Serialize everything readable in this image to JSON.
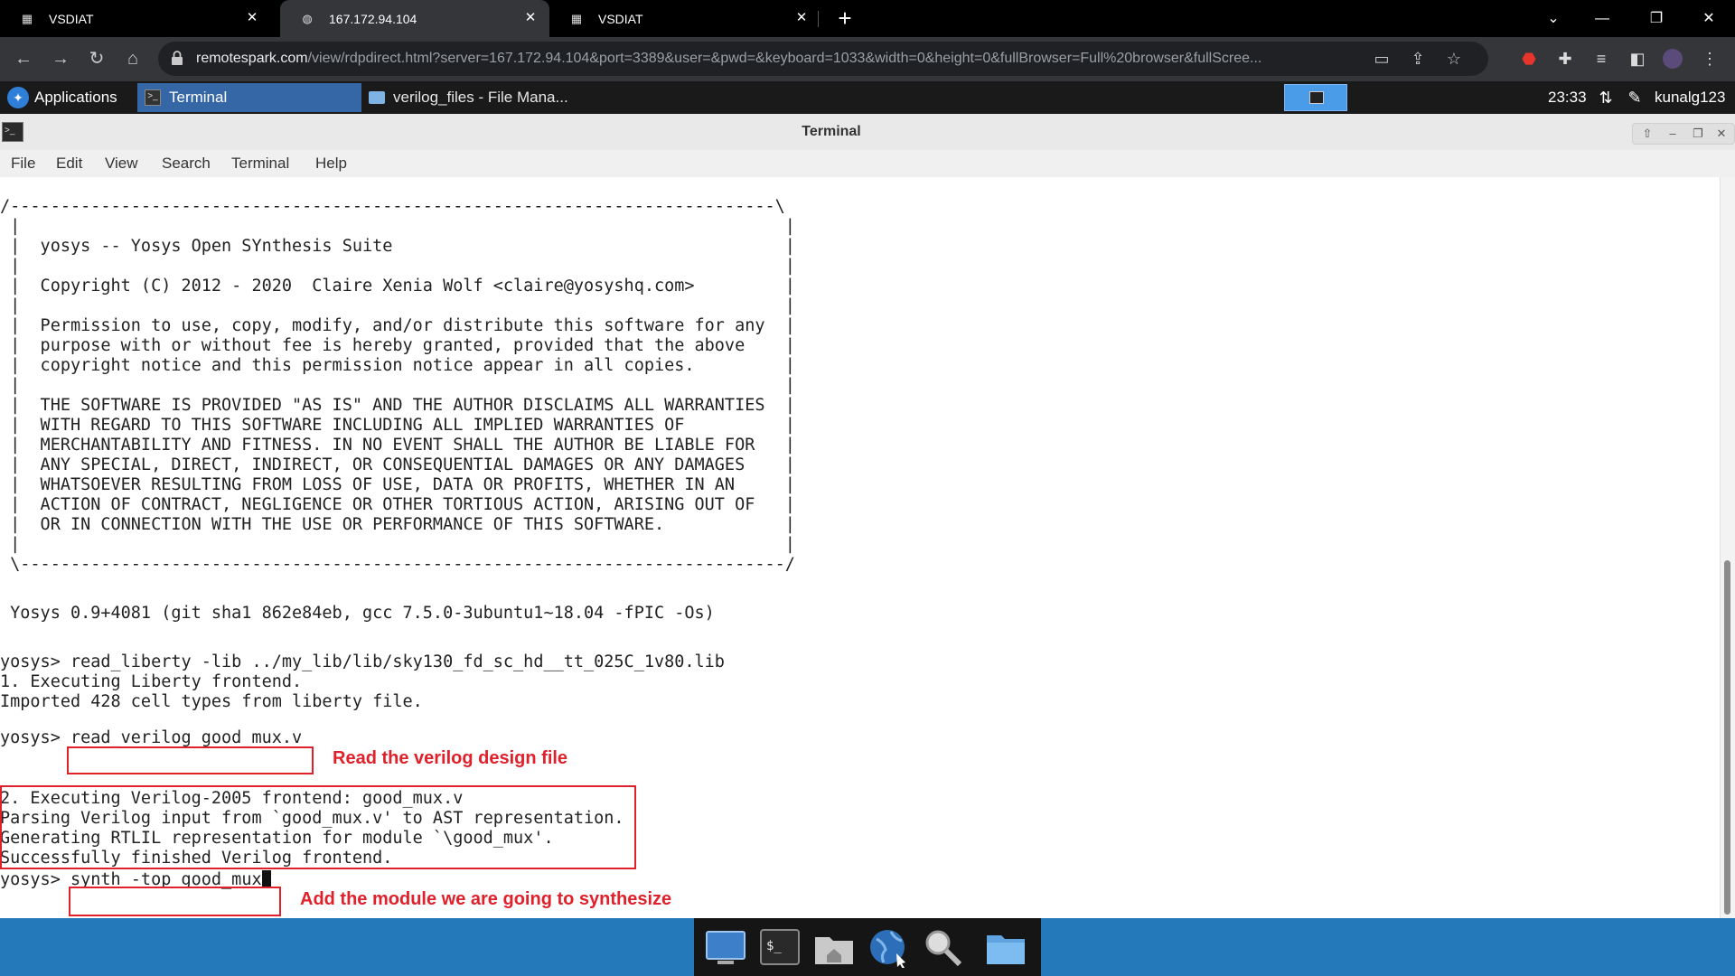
{
  "browser": {
    "tabs": [
      {
        "label": "VSDIAT",
        "active": false
      },
      {
        "label": "167.172.94.104",
        "active": true
      },
      {
        "label": "VSDIAT",
        "active": false
      }
    ],
    "url_domain": "remotespark.com",
    "url_path": "/view/rdpdirect.html?server=167.172.94.104&port=3389&user=&pwd=&keyboard=1033&width=0&height=0&fullBrowser=Full%20browser&fullScree..."
  },
  "panel": {
    "applications_label": "Applications",
    "tasks": [
      {
        "label": "Terminal",
        "active": true
      },
      {
        "label": "verilog_files - File Mana...",
        "active": false
      }
    ],
    "clock": "23:33",
    "user": "kunalg123"
  },
  "window": {
    "title": "Terminal",
    "menu": [
      "File",
      "Edit",
      "View",
      "Search",
      "Terminal",
      "Help"
    ]
  },
  "terminal": {
    "banner": [
      "/----------------------------------------------------------------------------\\",
      " |                                                                            |",
      " |  yosys -- Yosys Open SYnthesis Suite                                       |",
      " |                                                                            |",
      " |  Copyright (C) 2012 - 2020  Claire Xenia Wolf <claire@yosyshq.com>         |",
      " |                                                                            |",
      " |  Permission to use, copy, modify, and/or distribute this software for any  |",
      " |  purpose with or without fee is hereby granted, provided that the above    |",
      " |  copyright notice and this permission notice appear in all copies.         |",
      " |                                                                            |",
      " |  THE SOFTWARE IS PROVIDED \"AS IS\" AND THE AUTHOR DISCLAIMS ALL WARRANTIES  |",
      " |  WITH REGARD TO THIS SOFTWARE INCLUDING ALL IMPLIED WARRANTIES OF          |",
      " |  MERCHANTABILITY AND FITNESS. IN NO EVENT SHALL THE AUTHOR BE LIABLE FOR   |",
      " |  ANY SPECIAL, DIRECT, INDIRECT, OR CONSEQUENTIAL DAMAGES OR ANY DAMAGES    |",
      " |  WHATSOEVER RESULTING FROM LOSS OF USE, DATA OR PROFITS, WHETHER IN AN     |",
      " |  ACTION OF CONTRACT, NEGLIGENCE OR OTHER TORTIOUS ACTION, ARISING OUT OF   |",
      " |  OR IN CONNECTION WITH THE USE OR PERFORMANCE OF THIS SOFTWARE.            |",
      " |                                                                            |",
      " \\----------------------------------------------------------------------------/"
    ],
    "version": " Yosys 0.9+4081 (git sha1 862e84eb, gcc 7.5.0-3ubuntu1~18.04 -fPIC -Os)",
    "prompt": "yosys> ",
    "cmd1": "read_liberty -lib ../my_lib/lib/sky130_fd_sc_hd__tt_025C_1v80.lib",
    "out1": [
      "1. Executing Liberty frontend.",
      "Imported 428 cell types from liberty file."
    ],
    "cmd2": "read_verilog good_mux.v",
    "out2": [
      "2. Executing Verilog-2005 frontend: good_mux.v",
      "Parsing Verilog input from `good_mux.v' to AST representation.",
      "Generating RTLIL representation for module `\\good_mux'.",
      "Successfully finished Verilog frontend."
    ],
    "cmd3": "synth -top good_mux"
  },
  "annotations": {
    "note1": "Read the verilog design file",
    "note2": "Add the module we are going to synthesize",
    "color": "#e0202a"
  },
  "dock": {
    "icons": [
      "desktop-icon",
      "terminal-icon",
      "home-folder-icon",
      "web-browser-icon",
      "search-icon",
      "folder-icon"
    ]
  }
}
